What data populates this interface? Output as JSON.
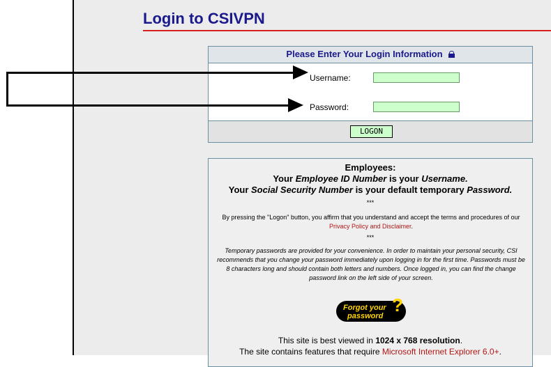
{
  "page": {
    "title": "Login to CSIVPN"
  },
  "login": {
    "header": "Please Enter Your Login Information",
    "username_label": "Username:",
    "username_value": "",
    "password_label": "Password:",
    "password_value": "",
    "logon_button": "LOGON"
  },
  "info": {
    "heading": "Employees:",
    "line1_a": "Your ",
    "line1_b": "Employee ID Number",
    "line1_c": " is your ",
    "line1_d": "Username.",
    "line2_a": "Your ",
    "line2_b": "Social Security Number",
    "line2_c": " is your default temporary ",
    "line2_d": "Password.",
    "stars": "***",
    "affirm_a": "By pressing the \"Logon\" button, you affirm that you understand and accept the terms and procedures of our ",
    "affirm_link": "Privacy Policy and Disclaimer",
    "affirm_end": ".",
    "temp_pw": "Temporary passwords are provided for your convenience. In order to maintain your personal security, CSI recommends that you change your password immediately upon logging in for the first time. Passwords must be 8 characters long and should contain both letters and numbers. Once logged in, you can find the change password link on the left side of your screen.",
    "forgot_line1": "Forgot your",
    "forgot_line2": "password",
    "forgot_q": "?",
    "res_a": "This site is best viewed in ",
    "res_b": "1024 x 768 resolution",
    "res_c": ".",
    "req_a": "The site contains features that require ",
    "req_link": "Microsoft Internet Explorer 6.0+",
    "req_end": "."
  },
  "colors": {
    "title": "#1a1a8c",
    "rule": "#d62020",
    "field": "#ccffcc",
    "link": "#b01616",
    "forgot_text": "#ffd400"
  }
}
